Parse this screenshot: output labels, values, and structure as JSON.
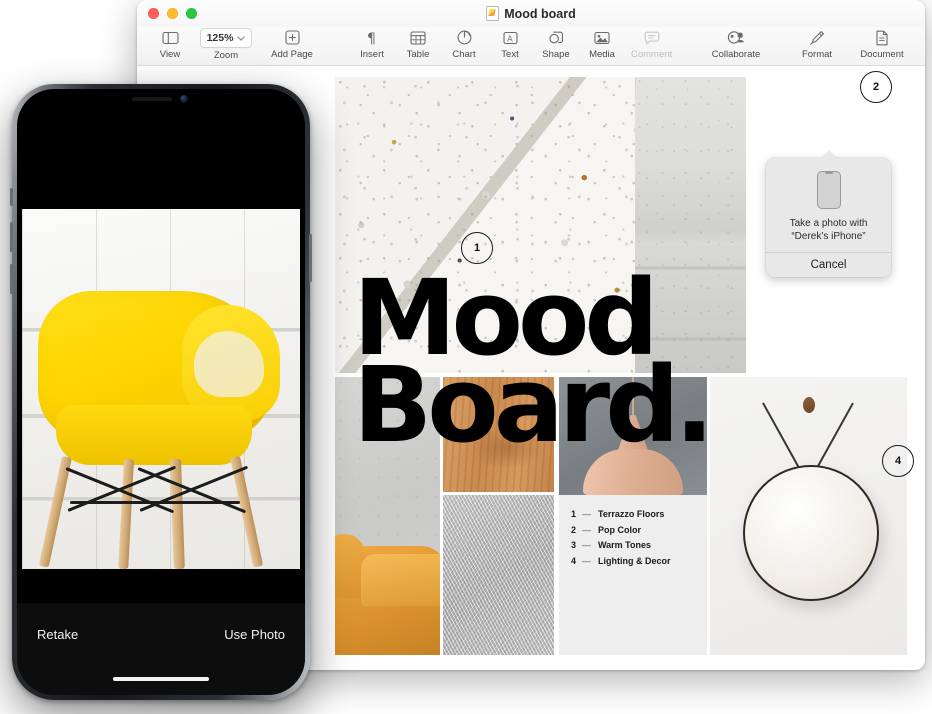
{
  "window": {
    "title": "Mood board",
    "zoom_level": "125%",
    "traffic_lights": [
      "close",
      "minimize",
      "zoom"
    ],
    "toolbar_left": [
      {
        "label": "View",
        "icon": "sidebar-icon",
        "enabled": true
      },
      {
        "label": "Zoom",
        "icon": "zoom-dropdown-icon",
        "enabled": true
      },
      {
        "label": "Add Page",
        "icon": "add-page-icon",
        "enabled": true
      }
    ],
    "toolbar_center": [
      {
        "label": "Insert",
        "icon": "pilcrow-icon",
        "enabled": true
      },
      {
        "label": "Table",
        "icon": "table-icon",
        "enabled": true
      },
      {
        "label": "Chart",
        "icon": "chart-icon",
        "enabled": true
      },
      {
        "label": "Text",
        "icon": "text-box-icon",
        "enabled": true
      },
      {
        "label": "Shape",
        "icon": "shape-icon",
        "enabled": true
      },
      {
        "label": "Media",
        "icon": "media-icon",
        "enabled": true
      },
      {
        "label": "Comment",
        "icon": "comment-icon",
        "enabled": false
      }
    ],
    "toolbar_collaborate": [
      {
        "label": "Collaborate",
        "icon": "collaborate-icon",
        "enabled": true
      }
    ],
    "toolbar_right": [
      {
        "label": "Format",
        "icon": "paintbrush-icon",
        "enabled": true
      },
      {
        "label": "Document",
        "icon": "document-icon",
        "enabled": true
      }
    ]
  },
  "document": {
    "heading_line1": "Mood",
    "heading_line2": "Board.",
    "callouts": [
      {
        "number": "1",
        "name": "callout-1"
      },
      {
        "number": "2",
        "name": "callout-2"
      },
      {
        "number": "4",
        "name": "callout-4"
      }
    ],
    "legend": [
      {
        "num": "1",
        "dash": "—",
        "label": "Terrazzo Floors"
      },
      {
        "num": "2",
        "dash": "—",
        "label": "Pop Color"
      },
      {
        "num": "3",
        "dash": "—",
        "label": "Warm Tones"
      },
      {
        "num": "4",
        "dash": "—",
        "label": "Lighting & Decor"
      }
    ]
  },
  "popover": {
    "icon": "iphone-icon",
    "message_line1": "Take a photo with",
    "message_line2": "“Derek’s iPhone”",
    "cancel_label": "Cancel"
  },
  "phone": {
    "retake_label": "Retake",
    "use_photo_label": "Use Photo"
  },
  "colors": {
    "accent_yellow": "#ffd400",
    "close_red": "#ff5f56",
    "min_yellow": "#ffbd2e",
    "zoom_green": "#28c940",
    "lamp_pink": "#dfaf93",
    "sofa_tan": "#d88f2c"
  }
}
